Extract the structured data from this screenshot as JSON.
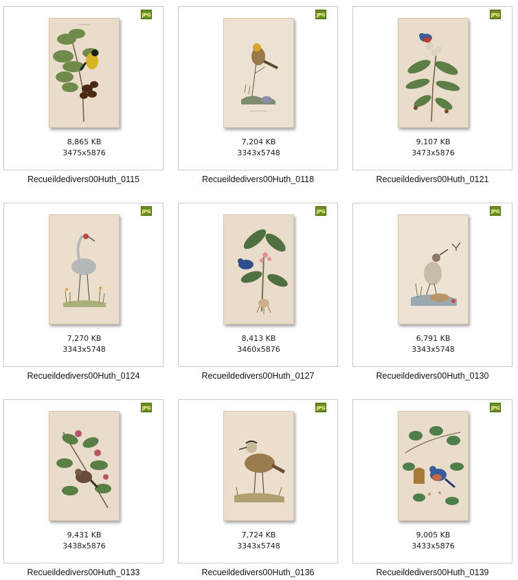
{
  "badge_label": "JPG",
  "colors": {
    "plate_paper": "#e9dccb",
    "badge_green": "#6b8f1f",
    "tile_border": "#c9c9c9"
  },
  "files": [
    {
      "name": "Recueildedivers00Huth_0115",
      "size": "8,865 KB",
      "dimensions": "3475x5876",
      "illustration": "yellow-finch-on-acacia"
    },
    {
      "name": "Recueildedivers00Huth_0118",
      "size": "7,204 KB",
      "dimensions": "3343x5748",
      "illustration": "bunting-on-twig"
    },
    {
      "name": "Recueildedivers00Huth_0121",
      "size": "9,107 KB",
      "dimensions": "3473x5876",
      "illustration": "painted-bunting-on-plant"
    },
    {
      "name": "Recueildedivers00Huth_0124",
      "size": "7,270 KB",
      "dimensions": "3343x5748",
      "illustration": "crane-in-reeds"
    },
    {
      "name": "Recueildedivers00Huth_0127",
      "size": "8,413 KB",
      "dimensions": "3460x5876",
      "illustration": "blue-bird-on-lily"
    },
    {
      "name": "Recueildedivers00Huth_0130",
      "size": "6,791 KB",
      "dimensions": "3343x5748",
      "illustration": "lark-on-rocks"
    },
    {
      "name": "Recueildedivers00Huth_0133",
      "size": "9,431 KB",
      "dimensions": "3438x5876",
      "illustration": "waxwing-on-flowering-branch"
    },
    {
      "name": "Recueildedivers00Huth_0136",
      "size": "7,724 KB",
      "dimensions": "3343x5748",
      "illustration": "plover-on-ground"
    },
    {
      "name": "Recueildedivers00Huth_0139",
      "size": "9,005 KB",
      "dimensions": "3433x5876",
      "illustration": "bluebird-on-stump-with-vine"
    }
  ]
}
